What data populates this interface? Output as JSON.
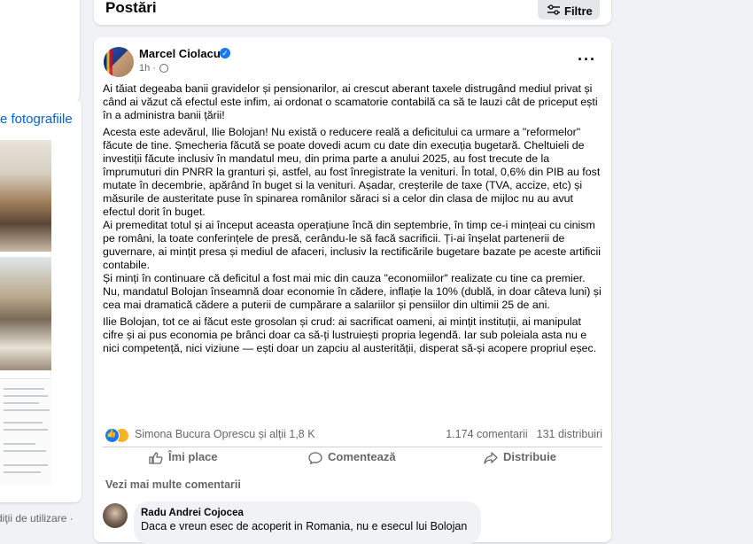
{
  "left_column": {
    "see_photos_link": "e fotografiile",
    "footer_text": "diţii de utilizare ·"
  },
  "header": {
    "title": "Postări",
    "filter_label": "Filtre"
  },
  "post": {
    "author": "Marcel Ciolacu",
    "time": "1h ·",
    "more_icon": "···",
    "paragraphs": [
      "Ai tăiat degeaba banii gravidelor și pensionarilor, ai crescut aberant taxele distrugând mediul privat și când ai văzut că efectul este infim, ai ordonat o scamatorie contabilă ca să te lauzi cât de priceput ești în a administra banii țării!",
      "Acesta este adevărul, Ilie Bolojan! Nu există o reducere reală a deficitului ca urmare a \"reformelor\" făcute de tine. Șmecheria făcută se poate dovedi acum cu date din execuția bugetară.  Cheltuieli de investiții făcute inclusiv în mandatul meu, din prima parte a anului 2025, au fost trecute de la împrumuturi din PNRR la granturi și, astfel, au fost înregistrate la venituri. În total, 0,6% din PIB au fost mutate în decembrie, apărând în buget si la venituri. Așadar, creșterile de taxe (TVA, accize, etc) și măsurile de austeritate puse în spinarea românilor  săraci si a celor din clasa de mijloc nu au avut efectul dorit în buget.\nAi premeditat totul și ai început aceasta operațiune încă din septembrie, în timp ce-i mințeai cu cinism pe români, la toate conferințele de presă, cerându-le să facă sacrificii. Ți-ai înșelat partenerii de guvernare, ai mințit presa și mediul de afaceri, inclusiv la rectificările bugetare bazate pe aceste artificii contabile.\nȘi minți în continuare că deficitul a fost mai mic din cauza \"economiilor\" realizate cu tine ca premier. Nu, mandatul Bolojan înseamnă doar economie în cădere, inflație la 10% (dublă, in doar câteva luni) și cea mai dramatică cădere a puterii de cumpărare a salariilor și pensiilor din ultimii 25 de ani.",
      "Ilie Bolojan, tot ce ai făcut este grosolan și crud: ai sacrificat oameni, ai mințit instituții, ai manipulat cifre și ai pus economia pe brânci doar ca să-ți lustruiești propria legendă. Iar sub poleiala asta nu e nici competență, nici viziune — ești doar un zapciu al austerității, disperat să-și acopere propriul eșec."
    ],
    "reactions_text": "Simona Bucura Oprescu și alții 1,8 K",
    "comments_count": "1.174 comentarii",
    "shares_count": "131 distribuiri",
    "actions": {
      "like": "Îmi place",
      "comment": "Comentează",
      "share": "Distribuie"
    },
    "more_comments": "Vezi mai multe comentarii",
    "comment": {
      "author": "Radu Andrei Cojocea",
      "text": "Daca e vreun esec de acoperit in Romania, nu e esecul lui Bolojan"
    }
  },
  "colors": {
    "page_background": "#f0f2f5",
    "link_blue": "#0064d1",
    "brand_blue": "#1877f2",
    "secondary_text": "#65676b"
  }
}
